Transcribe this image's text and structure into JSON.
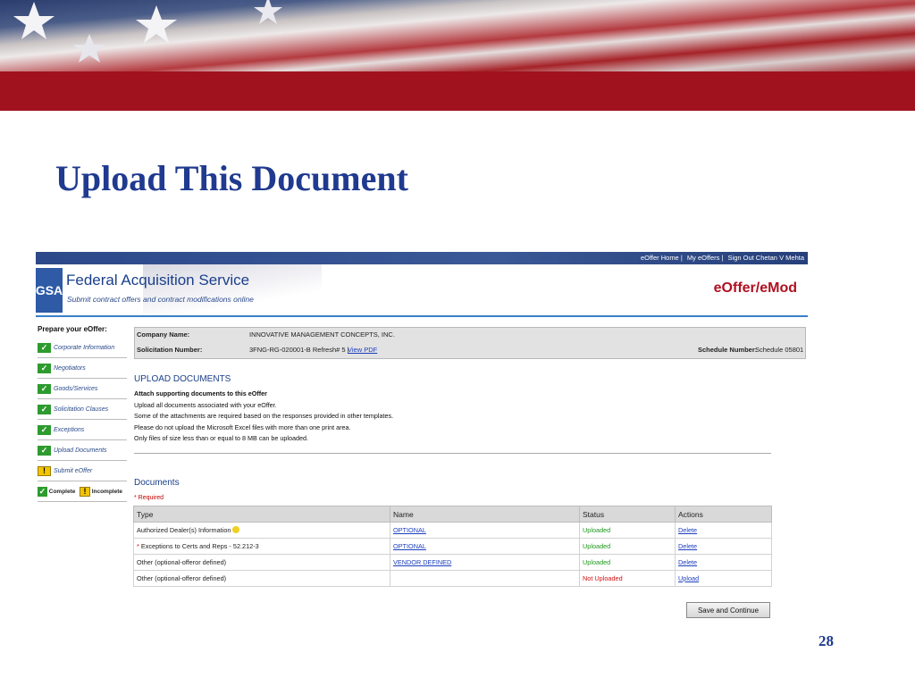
{
  "slide": {
    "title": "Upload This Document",
    "page_number": "28"
  },
  "portal": {
    "top_links": [
      "eOffer Home |",
      "My eOffers |",
      "Sign Out Chetan V Mehta"
    ],
    "logo": "GSA",
    "service_name": "Federal Acquisition Service",
    "tagline": "Submit contract offers and contract modifications online",
    "app_name": "eOffer/eMod"
  },
  "nav": {
    "title": "Prepare your eOffer:",
    "items": [
      {
        "label": "Corporate Information",
        "status": "complete"
      },
      {
        "label": "Negotiators",
        "status": "complete"
      },
      {
        "label": "Goods/Services",
        "status": "complete"
      },
      {
        "label": "Solicitation Clauses",
        "status": "complete"
      },
      {
        "label": "Exceptions",
        "status": "complete"
      },
      {
        "label": "Upload Documents",
        "status": "complete"
      },
      {
        "label": "Submit eOffer",
        "status": "incomplete"
      }
    ],
    "legend": {
      "complete": "Complete",
      "incomplete": "Incomplete"
    }
  },
  "info": {
    "company_label": "Company Name:",
    "company_value": "INNOVATIVE MANAGEMENT CONCEPTS, INC.",
    "solicitation_label": "Solicitation Number:",
    "solicitation_value": "3FNG-RG-020001-B Refresh# 5 |",
    "view_pdf": "View PDF",
    "schedule_label": "Schedule Number:",
    "schedule_value": "Schedule 05801"
  },
  "upload": {
    "title": "UPLOAD DOCUMENTS",
    "subtitle": "Attach supporting documents to this eOffer",
    "lines": [
      "Upload all documents associated with your eOffer.",
      "Some of the attachments are required based on the responses provided in other templates.",
      "Please do not upload the Microsoft Excel files with more than one print area.",
      "Only files of size less than or equal to 8 MB can be uploaded."
    ]
  },
  "documents": {
    "title": "Documents",
    "required_note": "* Required",
    "headers": [
      "Type",
      "Name",
      "Status",
      "Actions"
    ],
    "rows": [
      {
        "required": false,
        "type": "Authorized Dealer(s) Information",
        "has_tip": true,
        "name": "OPTIONAL",
        "status": "Uploaded",
        "status_kind": "ok",
        "action": "Delete"
      },
      {
        "required": true,
        "type": "Exceptions to Certs and Reps - 52.212-3",
        "has_tip": false,
        "name": "OPTIONAL",
        "status": "Uploaded",
        "status_kind": "ok",
        "action": "Delete"
      },
      {
        "required": false,
        "type": "Other (optional-offeror defined)",
        "has_tip": false,
        "name": "VENDOR DEFINED",
        "status": "Uploaded",
        "status_kind": "ok",
        "action": "Delete"
      },
      {
        "required": false,
        "type": "Other (optional-offeror defined)",
        "has_tip": false,
        "name": "",
        "status": "Not Uploaded",
        "status_kind": "missing",
        "action": "Upload"
      }
    ],
    "save_button": "Save and Continue"
  },
  "colors": {
    "title_blue": "#1f3a8f",
    "banner_red": "#a0121e",
    "status_green": "#1f9a1f",
    "status_red": "#d01010",
    "link_blue": "#1c3fbf"
  }
}
